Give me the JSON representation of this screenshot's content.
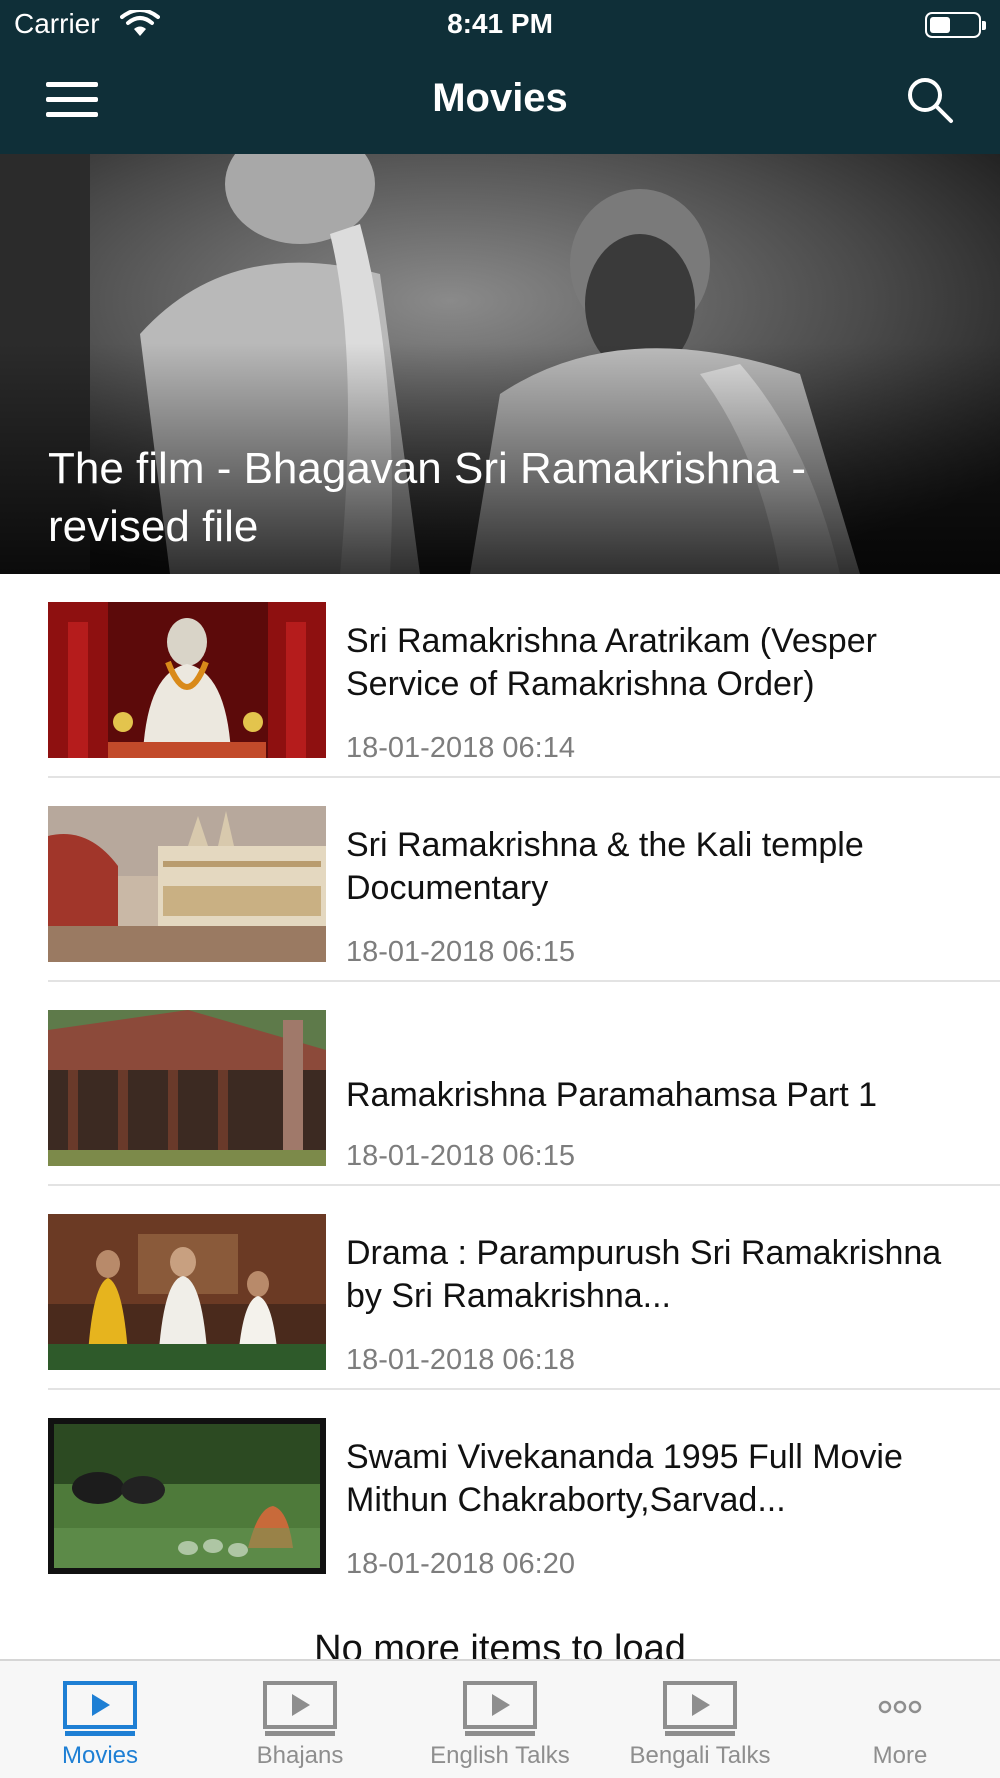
{
  "status_bar": {
    "carrier": "Carrier",
    "time": "8:41 PM"
  },
  "nav": {
    "title": "Movies",
    "menu_icon": "hamburger-menu-icon",
    "search_icon": "search-icon"
  },
  "hero": {
    "title": "The film - Bhagavan Sri Ramakrishna - revised file"
  },
  "items": [
    {
      "title": "Sri Ramakrishna Aratrikam (Vesper Service of Ramakrishna Order)",
      "date": "18-01-2018 06:14"
    },
    {
      "title": "Sri Ramakrishna & the Kali temple Documentary",
      "date": "18-01-2018 06:15"
    },
    {
      "title": "Ramakrishna Paramahamsa Part 1",
      "date": "18-01-2018 06:15"
    },
    {
      "title": "Drama : Parampurush Sri Ramakrishna by Sri Ramakrishna...",
      "date": "18-01-2018 06:18"
    },
    {
      "title": "Swami Vivekananda 1995 Full Movie Mithun Chakraborty,Sarvad...",
      "date": "18-01-2018 06:20"
    }
  ],
  "footer_text": "No more items to load",
  "tabs": [
    {
      "label": "Movies",
      "icon": "play-icon",
      "active": true
    },
    {
      "label": "Bhajans",
      "icon": "play-icon",
      "active": false
    },
    {
      "label": "English Talks",
      "icon": "play-icon",
      "active": false
    },
    {
      "label": "Bengali Talks",
      "icon": "play-icon",
      "active": false
    },
    {
      "label": "More",
      "icon": "more-icon",
      "active": false
    }
  ],
  "colors": {
    "header_bg": "#0f2f38",
    "active_tab": "#1e7fd4",
    "inactive_tab": "#8e8e8e",
    "date_text": "#7d7d7d"
  }
}
